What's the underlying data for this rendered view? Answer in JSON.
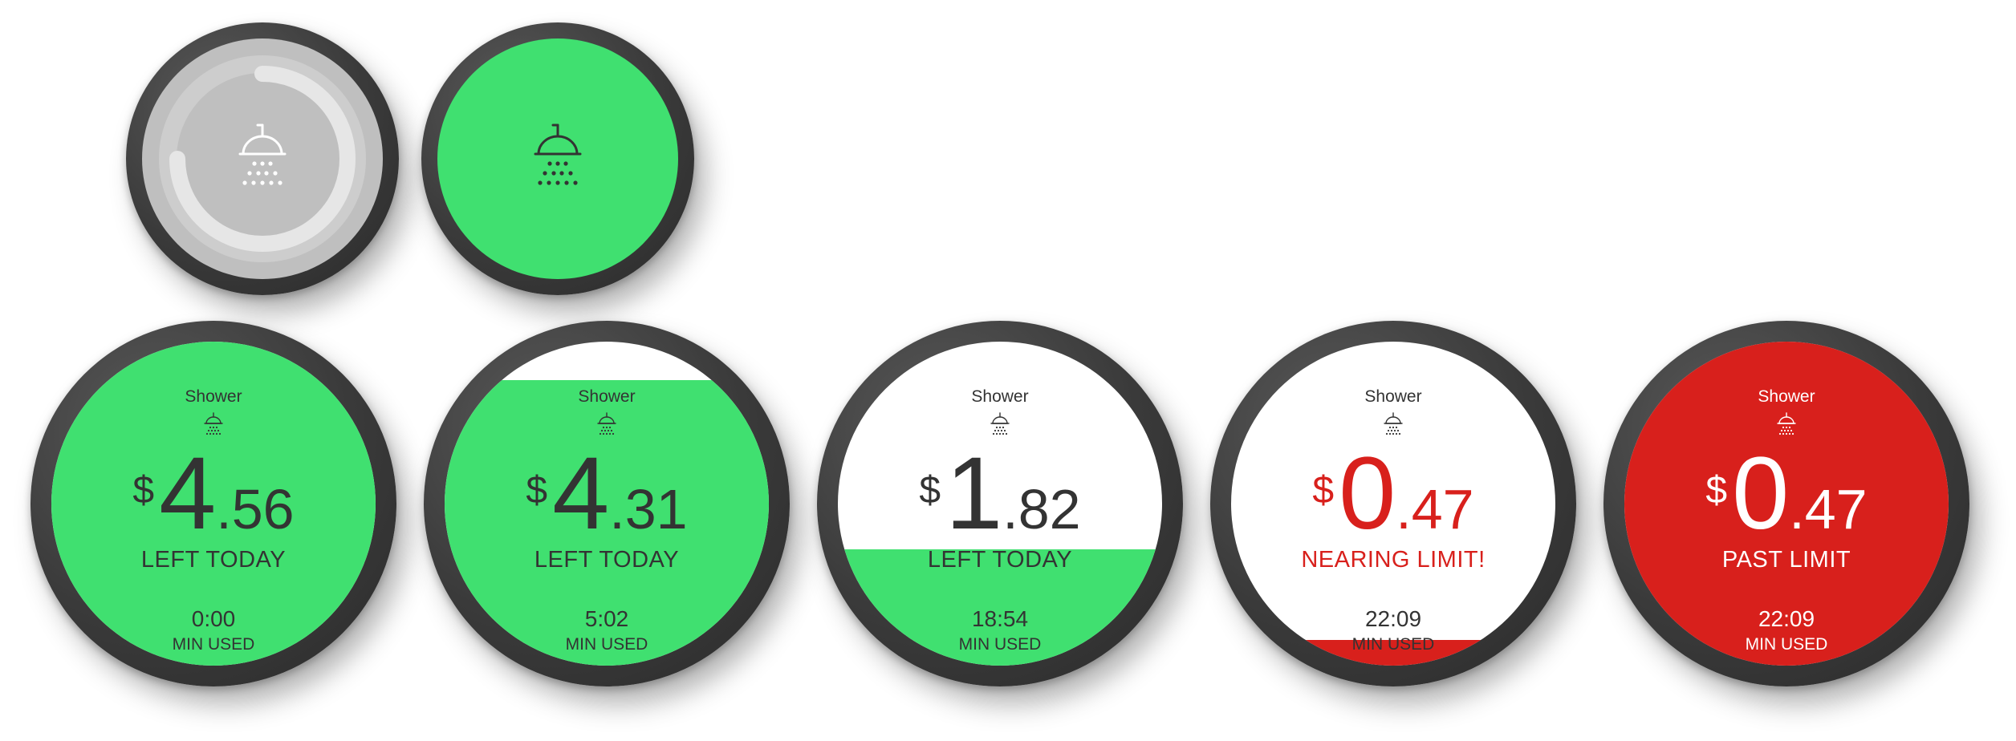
{
  "colors": {
    "green": "#40e070",
    "red": "#d8201c",
    "gray": "#bfbfbf",
    "dark_text": "#333333",
    "bezel": "#3a3a3a"
  },
  "icons": {
    "shower": "shower-head-icon",
    "progress": "loading-arc-icon"
  },
  "launch_screens": [
    {
      "state": "loading",
      "icon": "shower-head-icon"
    },
    {
      "state": "ready",
      "icon": "shower-head-icon"
    }
  ],
  "screens": [
    {
      "title": "Shower",
      "currency": "$",
      "dollars": "4",
      "cents": ".56",
      "status": "LEFT TODAY",
      "time": "0:00",
      "time_label": "MIN USED",
      "fill_fraction": 1.0,
      "fill_color": "#40e070"
    },
    {
      "title": "Shower",
      "currency": "$",
      "dollars": "4",
      "cents": ".31",
      "status": "LEFT TODAY",
      "time": "5:02",
      "time_label": "MIN USED",
      "fill_fraction": 0.88,
      "fill_color": "#40e070"
    },
    {
      "title": "Shower",
      "currency": "$",
      "dollars": "1",
      "cents": ".82",
      "status": "LEFT TODAY",
      "time": "18:54",
      "time_label": "MIN USED",
      "fill_fraction": 0.36,
      "fill_color": "#40e070"
    },
    {
      "title": "Shower",
      "currency": "$",
      "dollars": "0",
      "cents": ".47",
      "status": "NEARING LIMIT!",
      "time": "22:09",
      "time_label": "MIN USED",
      "fill_fraction": 0.08,
      "fill_color": "#d8201c"
    },
    {
      "title": "Shower",
      "currency": "$",
      "dollars": "0",
      "cents": ".47",
      "status": "PAST LIMIT",
      "time": "22:09",
      "time_label": "MIN USED",
      "fill_fraction": 1.0,
      "fill_color": "#d8201c"
    }
  ]
}
